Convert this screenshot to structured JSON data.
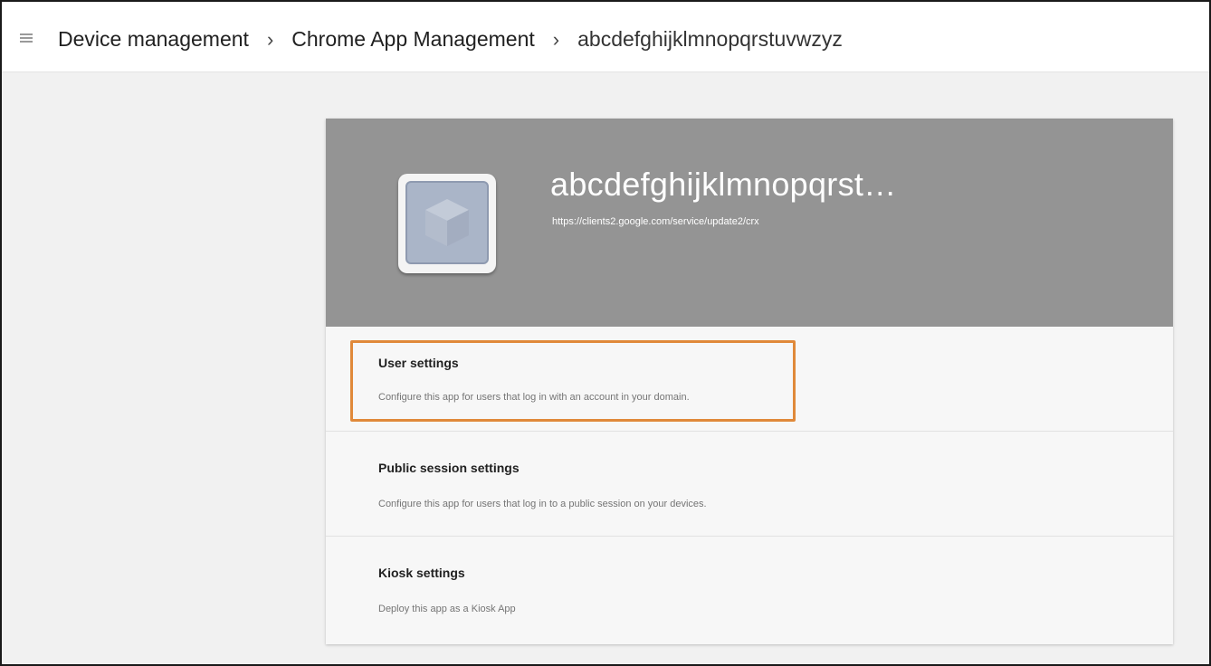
{
  "breadcrumb": {
    "items": [
      {
        "label": "Device management"
      },
      {
        "label": "Chrome App Management"
      },
      {
        "label": "abcdefghijklmnopqrstuvwzyz"
      }
    ],
    "separator": "›"
  },
  "app": {
    "name": "abcdefghijklmnopqrst…",
    "url": "https://clients2.google.com/service/update2/crx",
    "icon": "cube-icon"
  },
  "settings": [
    {
      "title": "User settings",
      "description": "Configure this app for users that log in with an account in your domain.",
      "highlighted": true
    },
    {
      "title": "Public session settings",
      "description": "Configure this app for users that log in to a public session on your devices.",
      "highlighted": false
    },
    {
      "title": "Kiosk settings",
      "description": "Deploy this app as a Kiosk App",
      "highlighted": false
    }
  ],
  "colors": {
    "hero": "#949494",
    "highlight": "#e0893a",
    "page_background": "#f1f1f1"
  }
}
